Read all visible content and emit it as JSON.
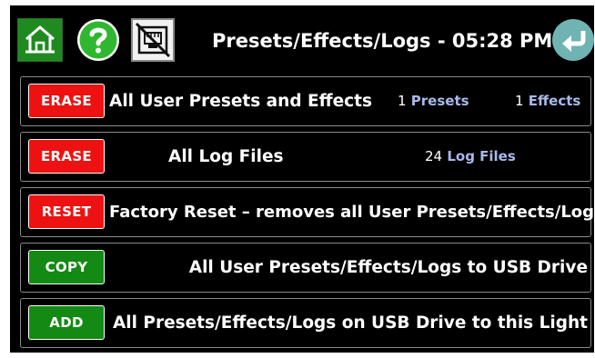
{
  "header": {
    "title": "Presets/Effects/Logs - 05:28 PM",
    "home_icon": "home-icon",
    "help_icon": "help-icon",
    "network_icon": "network-disconnected-icon",
    "back_icon": "back-arrow-icon"
  },
  "rows": [
    {
      "button": "ERASE",
      "label": "All User Presets and Effects",
      "counts": [
        {
          "num": "1",
          "unit": "Presets"
        },
        {
          "num": "1",
          "unit": "Effects"
        }
      ]
    },
    {
      "button": "ERASE",
      "label": "All Log Files",
      "counts": [
        {
          "num": "24",
          "unit": "Log Files"
        }
      ]
    },
    {
      "button": "RESET",
      "label": "Factory Reset – removes all User Presets/Effects/Logs"
    },
    {
      "button": "COPY",
      "label": "All User Presets/Effects/Logs to USB Drive"
    },
    {
      "button": "ADD",
      "label": "All Presets/Effects/Logs on USB Drive to this Light"
    }
  ],
  "colors": {
    "background": "#000000",
    "danger": "#ee1111",
    "success": "#138a13",
    "count_unit": "#a9b9ea",
    "help": "#2fb82f",
    "back": "#6fb3b3"
  }
}
